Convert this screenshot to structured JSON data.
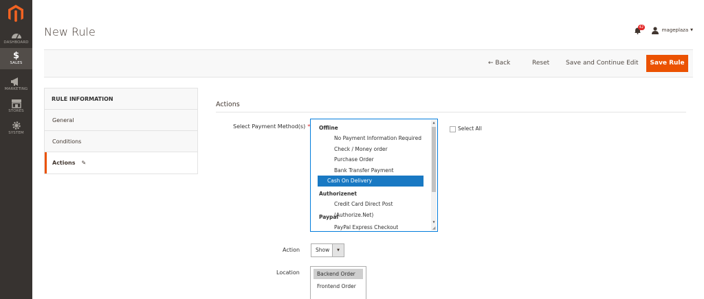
{
  "sidebar": {
    "items": [
      {
        "label": "DASHBOARD",
        "icon": "dashboard-icon"
      },
      {
        "label": "SALES",
        "icon": "dollar-icon"
      },
      {
        "label": "MARKETING",
        "icon": "megaphone-icon"
      },
      {
        "label": "STORES",
        "icon": "store-icon"
      },
      {
        "label": "SYSTEM",
        "icon": "gear-icon"
      }
    ]
  },
  "header": {
    "title": "New Rule",
    "notifications_count": "42",
    "username": "mageplaza"
  },
  "toolbar": {
    "back_label": "← Back",
    "reset_label": "Reset",
    "save_continue_label": "Save and Continue Edit",
    "save_label": "Save Rule"
  },
  "tabs": {
    "heading": "RULE INFORMATION",
    "items": [
      {
        "label": "General"
      },
      {
        "label": "Conditions"
      },
      {
        "label": "Actions"
      }
    ]
  },
  "actions_section": {
    "title": "Actions",
    "payment_label": "Select Payment Method(s)",
    "required_mark": "*",
    "payment_groups": [
      {
        "group": "Offline",
        "options": [
          "No Payment Information Required",
          "Check / Money order",
          "Purchase Order",
          "Bank Transfer Payment",
          "Cash On Delivery"
        ]
      },
      {
        "group": "Authorizenet",
        "options": [
          "Credit Card Direct Post (Authorize.Net)"
        ]
      },
      {
        "group": "Paypal",
        "options": [
          "PayPal Express Checkout"
        ]
      }
    ],
    "selected_payment": "Cash On Delivery",
    "select_all_label": "Select All",
    "action_label": "Action",
    "action_value": "Show",
    "location_label": "Location",
    "location_options": [
      "Backend Order",
      "Frontend Order"
    ],
    "location_selected": "Backend Order"
  },
  "colors": {
    "accent": "#eb5202",
    "sidebar_bg": "#373330",
    "selection": "#1979c3"
  }
}
